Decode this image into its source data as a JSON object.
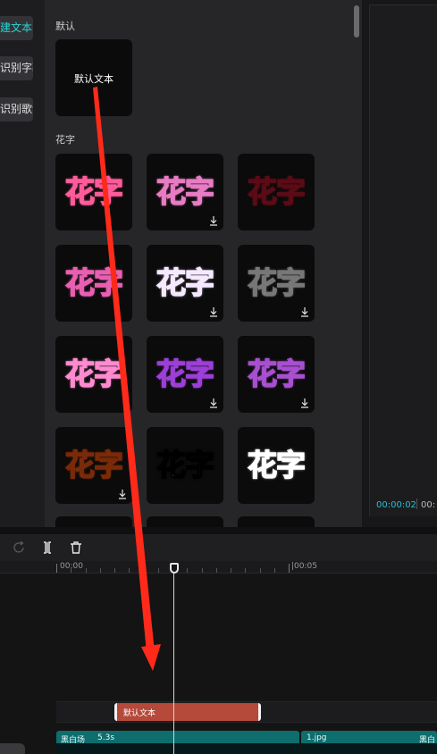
{
  "categories": [
    {
      "label": "建文本",
      "state": "active"
    },
    {
      "label": "识别字幕",
      "state": "inactive"
    },
    {
      "label": "识别歌词",
      "state": "inactive"
    }
  ],
  "panel": {
    "section_default": "默认",
    "default_tile_text": "默认文本",
    "section_huazi": "花字",
    "huazi_text": "花字",
    "tiles": [
      {
        "name": "huazi-pink-white",
        "download": false,
        "fill": "#ffffff",
        "stroke": "#ff5b9a",
        "fill2": "#ffffff"
      },
      {
        "name": "huazi-pink-glow",
        "download": true,
        "fill": "#ffffff",
        "stroke": "#e77bc4",
        "fill2": "#ffffff"
      },
      {
        "name": "huazi-red-sparkle",
        "download": false,
        "fill": "#d61a34",
        "stroke": "#5a0b16",
        "fill2": "#d61a34"
      },
      {
        "name": "huazi-pink-outline",
        "download": false,
        "fill": "#ffffff",
        "stroke": "#e85fb2",
        "fill2": "#ffffff"
      },
      {
        "name": "huazi-purple",
        "download": true,
        "fill": "#9b5bd6",
        "stroke": "#f5e9ff",
        "fill2": "#9b5bd6"
      },
      {
        "name": "huazi-white-sparkle",
        "download": true,
        "fill": "#f2f2f2",
        "stroke": "#777777",
        "fill2": "#f2f2f2"
      },
      {
        "name": "huazi-rainbow",
        "download": false,
        "fill": "#ffb3d9",
        "stroke": "#ff8ad0",
        "fill2": "#b6ff8a"
      },
      {
        "name": "huazi-yellow-purple",
        "download": true,
        "fill": "#ffd44a",
        "stroke": "#9b3fd6",
        "fill2": "#ffd44a"
      },
      {
        "name": "huazi-orange-purple",
        "download": true,
        "fill": "#ffe1a0",
        "stroke": "#a84fd0",
        "fill2": "#ffe1a0"
      },
      {
        "name": "huazi-orange",
        "download": true,
        "fill": "#e8521c",
        "stroke": "#7a2a08",
        "fill2": "#e8521c"
      },
      {
        "name": "huazi-white-red",
        "download": false,
        "fill": "#ffffff",
        "stroke": "#000000",
        "fill2": "#ee1c24"
      },
      {
        "name": "huazi-coral-glow",
        "download": false,
        "fill": "#ff8f7a",
        "stroke": "#ffffff",
        "fill2": "#ff8f7a"
      }
    ]
  },
  "preview": {
    "time_current": "00:00:02",
    "time_total": "00:"
  },
  "ruler": {
    "marks": [
      "00:00",
      "|00:05"
    ]
  },
  "tracks": {
    "text_clip_label": "默认文本",
    "video_clips": [
      {
        "label": "黑白场",
        "duration": "5.3s"
      },
      {
        "label": "1.jpg",
        "duration": ""
      },
      {
        "label": "黑白",
        "duration": ""
      }
    ]
  },
  "colors": {
    "accent": "#2bd4d4",
    "annotation_arrow": "#ff2a1a",
    "text_clip": "#b5493a",
    "video_clip": "#0e6d6d"
  },
  "icons": {
    "toolbar": [
      "redo-icon",
      "split-icon",
      "delete-icon"
    ],
    "tile_badge": "download-icon"
  }
}
